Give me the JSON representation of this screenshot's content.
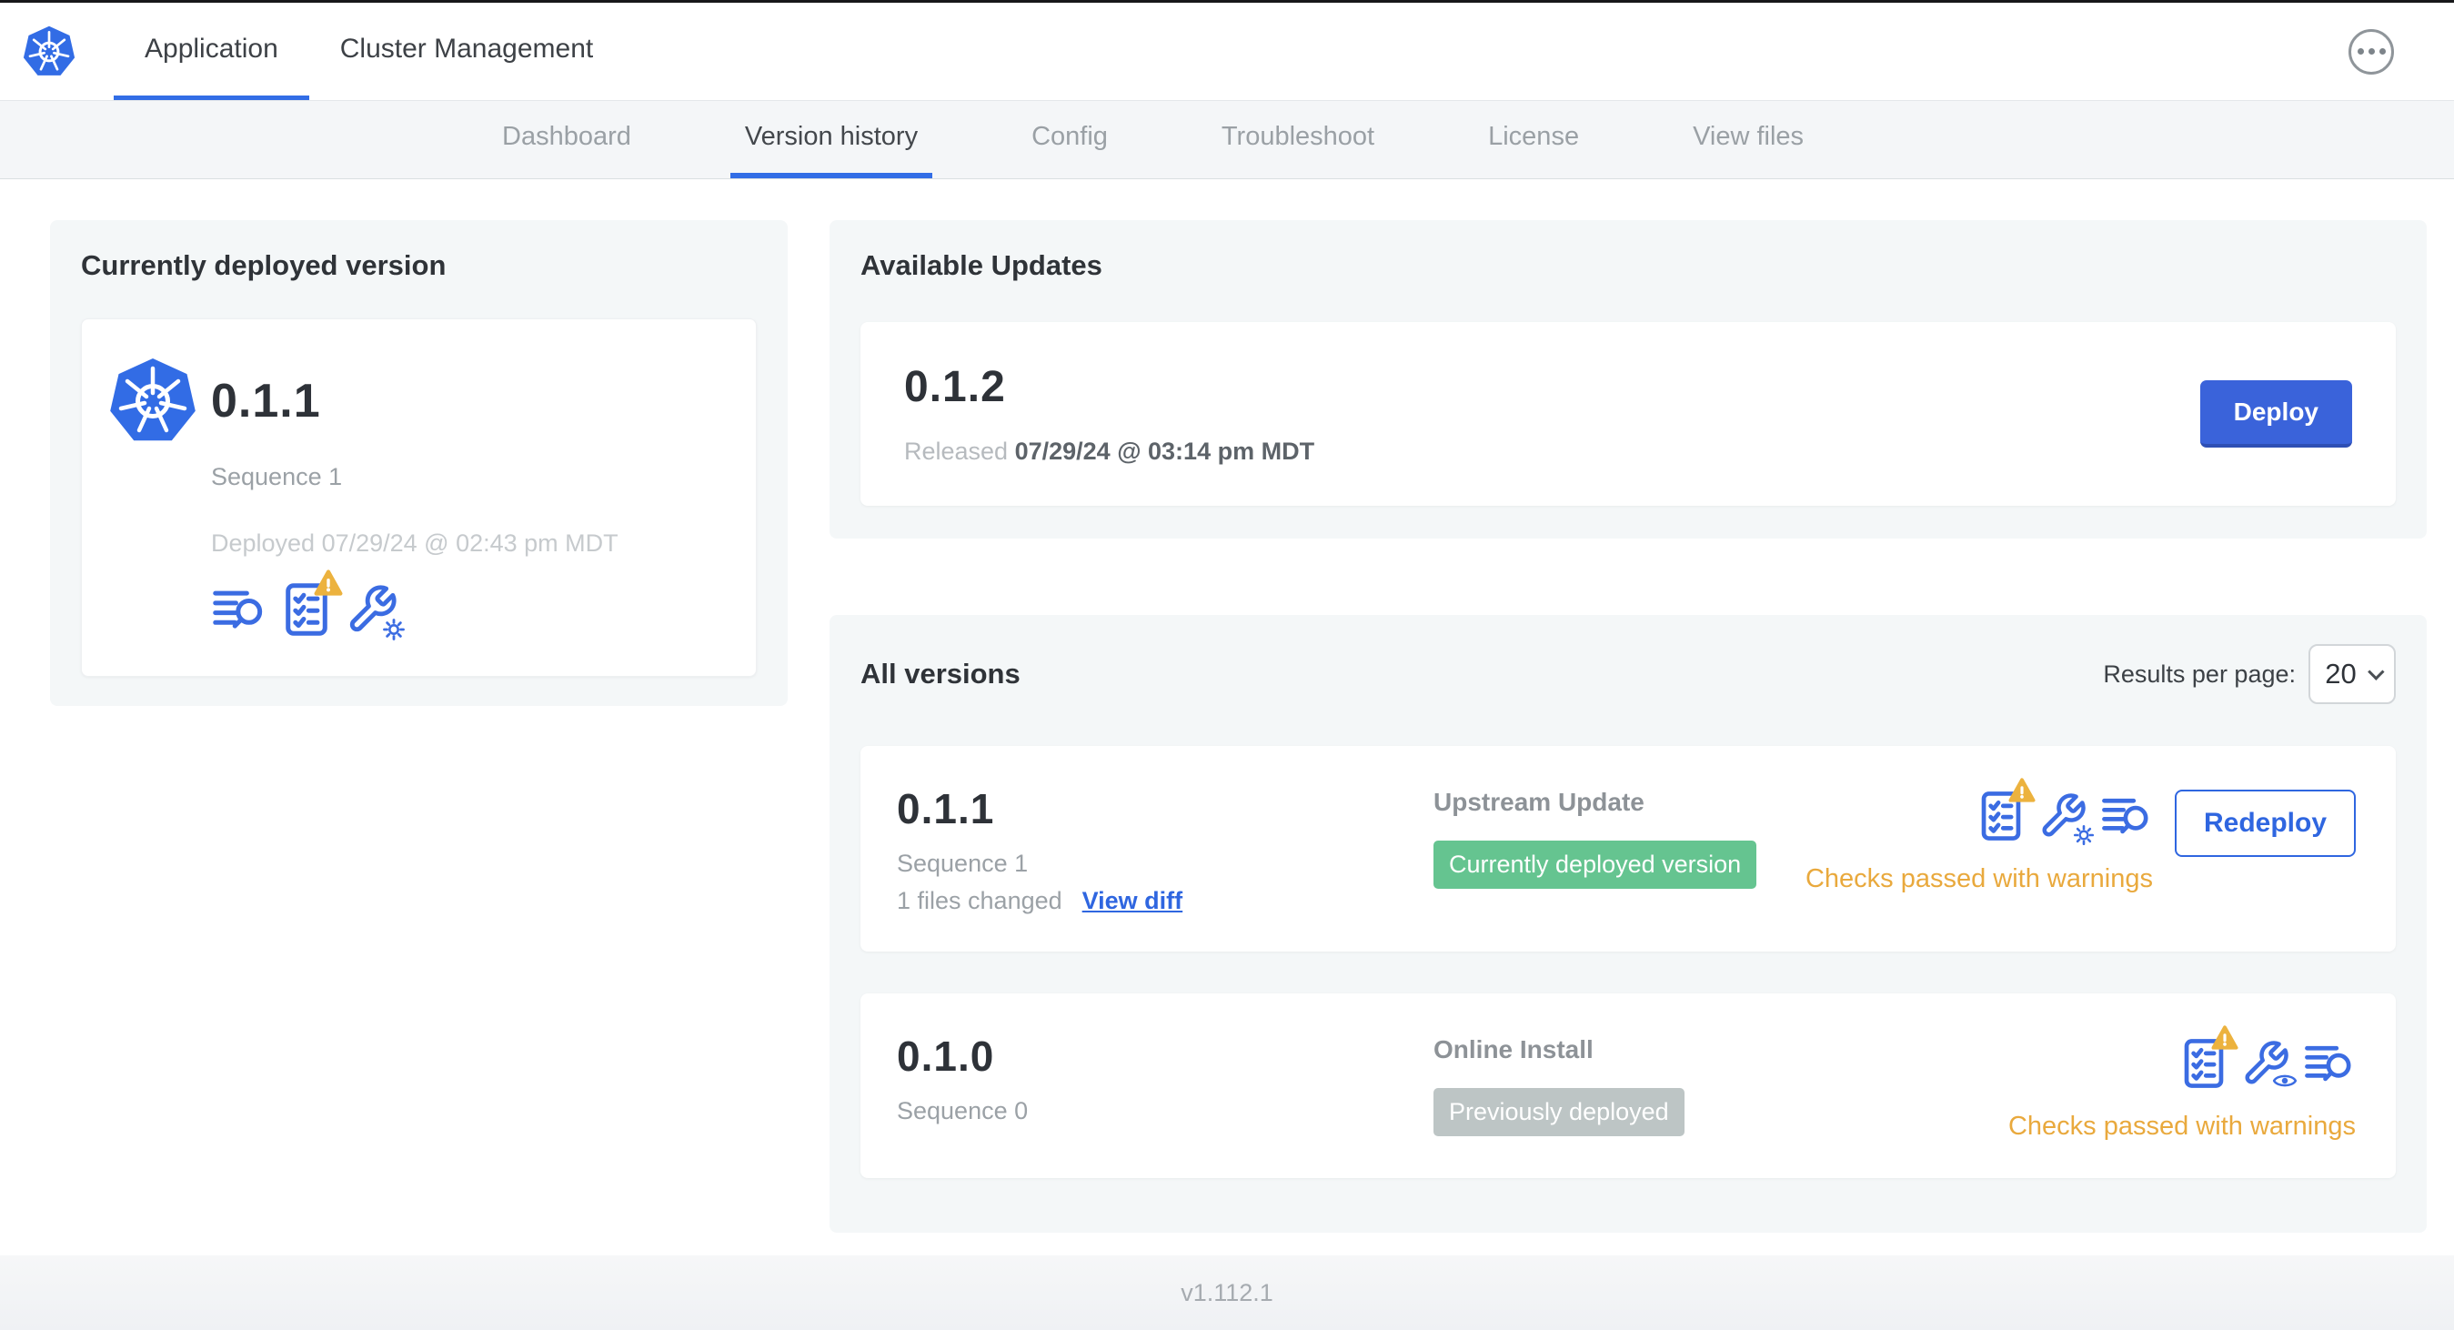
{
  "header": {
    "tabs": [
      {
        "label": "Application",
        "active": true
      },
      {
        "label": "Cluster Management",
        "active": false
      }
    ]
  },
  "subnav": {
    "tabs": [
      {
        "label": "Dashboard",
        "active": false
      },
      {
        "label": "Version history",
        "active": true
      },
      {
        "label": "Config",
        "active": false
      },
      {
        "label": "Troubleshoot",
        "active": false
      },
      {
        "label": "License",
        "active": false
      },
      {
        "label": "View files",
        "active": false
      }
    ]
  },
  "current_version": {
    "title": "Currently deployed version",
    "version": "0.1.1",
    "sequence": "Sequence 1",
    "deployed": "Deployed 07/29/24 @ 02:43 pm MDT"
  },
  "available_updates": {
    "title": "Available Updates",
    "version": "0.1.2",
    "released_label": "Released",
    "released_date": "07/29/24 @ 03:14 pm MDT",
    "deploy_button": "Deploy"
  },
  "all_versions": {
    "title": "All versions",
    "results_per_page_label": "Results per page:",
    "results_per_page_value": "20",
    "rows": [
      {
        "version": "0.1.1",
        "sequence": "Sequence 1",
        "files_changed": "1 files changed",
        "view_diff_link": "View diff",
        "source": "Upstream Update",
        "badge": "Currently deployed version",
        "badge_color": "#65c490",
        "action_button": "Redeploy",
        "status": "Checks passed with warnings"
      },
      {
        "version": "0.1.0",
        "sequence": "Sequence 0",
        "source": "Online Install",
        "badge": "Previously deployed",
        "badge_color": "#bdc5c5",
        "status": "Checks passed with warnings"
      }
    ]
  },
  "footer": {
    "app_version": "v1.112.1"
  },
  "colors": {
    "accent_blue": "#326de6",
    "icon_blue": "#3b6ce2",
    "button_blue": "#3a63da",
    "badge_green": "#65c490",
    "badge_gray": "#bdc5c5",
    "warning_amber": "#e9a93d",
    "nav_bg": "#f4f6f8",
    "card_bg": "#f4f7f8"
  }
}
